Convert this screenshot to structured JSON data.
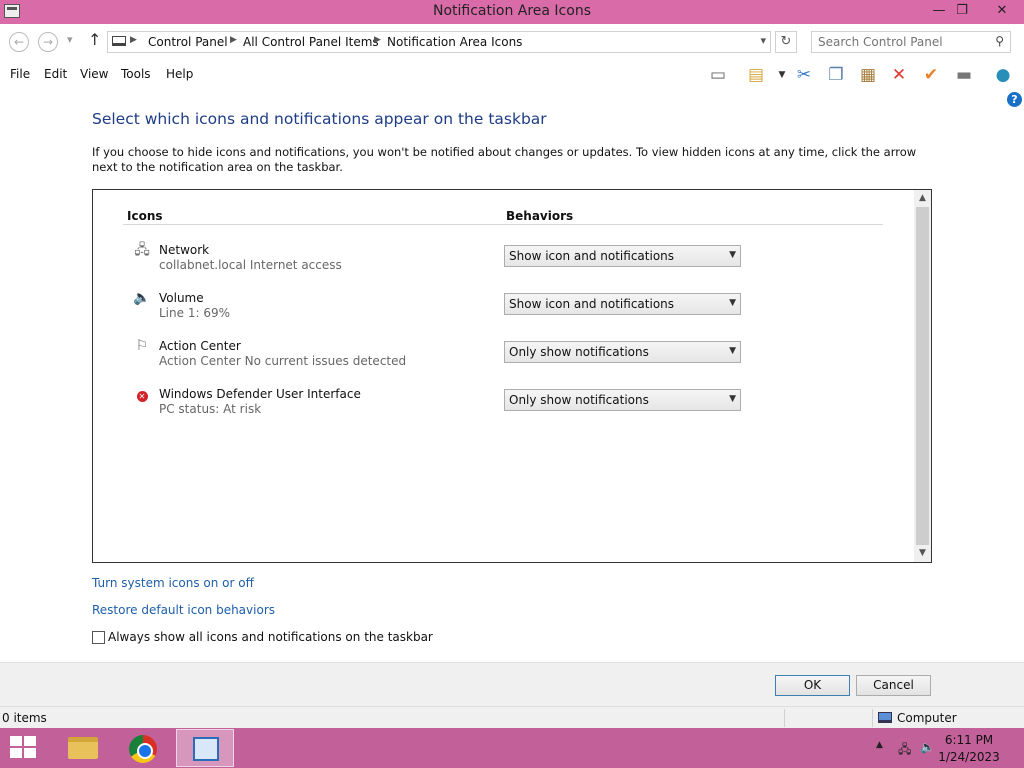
{
  "window": {
    "title": "Notification Area Icons",
    "controls": {
      "minimize": "—",
      "restore": "❐",
      "close": "✕"
    }
  },
  "address": {
    "crumbs": [
      "Control Panel",
      "All Control Panel Items",
      "Notification Area Icons"
    ],
    "search_placeholder": "Search Control Panel"
  },
  "menu": [
    "File",
    "Edit",
    "View",
    "Tools",
    "Help"
  ],
  "toolbar_icons": [
    "layout-icon",
    "properties-icon",
    "cut-icon",
    "copy-icon",
    "paste-icon",
    "delete-icon",
    "checkmark-icon",
    "rename-icon",
    "globe-icon"
  ],
  "main": {
    "heading": "Select which icons and notifications appear on the taskbar",
    "description": "If you choose to hide icons and notifications, you won't be notified about changes or updates. To view hidden icons at any time, click the arrow next to the notification area on the taskbar.",
    "columns": {
      "icons": "Icons",
      "behaviors": "Behaviors"
    },
    "rows": [
      {
        "icon": "network-icon",
        "name": "Network",
        "sub": "collabnet.local Internet access",
        "behavior": "Show icon and notifications"
      },
      {
        "icon": "volume-icon",
        "name": "Volume",
        "sub": "Line 1: 69%",
        "behavior": "Show icon and notifications"
      },
      {
        "icon": "flag-icon",
        "name": "Action Center",
        "sub": "Action Center  No current issues detected",
        "behavior": "Only show notifications"
      },
      {
        "icon": "defender-alert-icon",
        "name": "Windows Defender User Interface",
        "sub": "PC status: At risk",
        "behavior": "Only show notifications"
      }
    ],
    "links": {
      "system_icons": "Turn system icons on or off",
      "restore": "Restore default icon behaviors"
    },
    "always_show_label": "Always show all icons and notifications on the taskbar",
    "always_show_checked": false
  },
  "buttons": {
    "ok": "OK",
    "cancel": "Cancel"
  },
  "status": {
    "items": "0 items",
    "location": "Computer"
  },
  "taskbar": {
    "clock_time": "6:11 PM",
    "clock_date": "1/24/2023"
  }
}
